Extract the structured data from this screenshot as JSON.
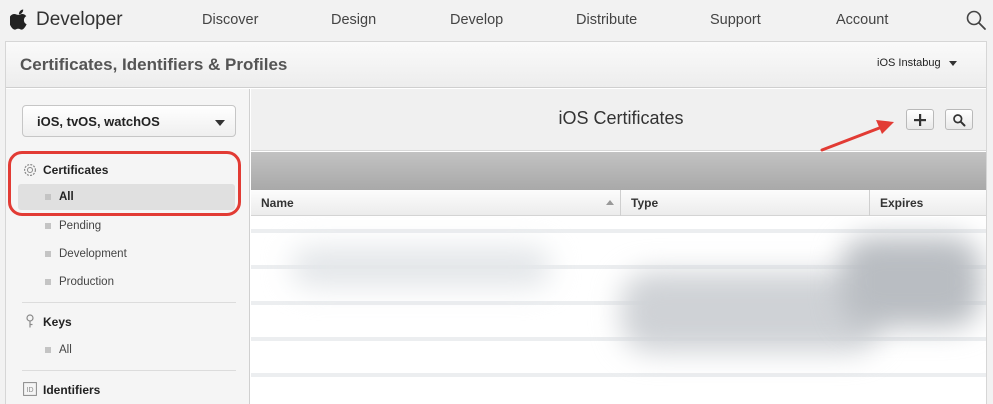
{
  "nav": {
    "brand": "Developer",
    "items": [
      "Discover",
      "Design",
      "Develop",
      "Distribute",
      "Support",
      "Account"
    ]
  },
  "header": {
    "title": "Certificates, Identifiers & Profiles",
    "team": "iOS Instabug"
  },
  "sidebar": {
    "platform": "iOS, tvOS, watchOS",
    "sections": [
      {
        "title": "Certificates",
        "icon": "certificate-icon",
        "items": [
          "All",
          "Pending",
          "Development",
          "Production"
        ]
      },
      {
        "title": "Keys",
        "icon": "key-icon",
        "items": [
          "All"
        ]
      },
      {
        "title": "Identifiers",
        "icon": "id-icon",
        "items": []
      }
    ],
    "selected": "All"
  },
  "content": {
    "title": "iOS Certificates",
    "add_button": "+",
    "search_icon": "search-icon",
    "columns": [
      "Name",
      "Type",
      "Expires"
    ]
  },
  "colors": {
    "annotation": "#e23b34",
    "page_bg": "#f2f2f2"
  }
}
